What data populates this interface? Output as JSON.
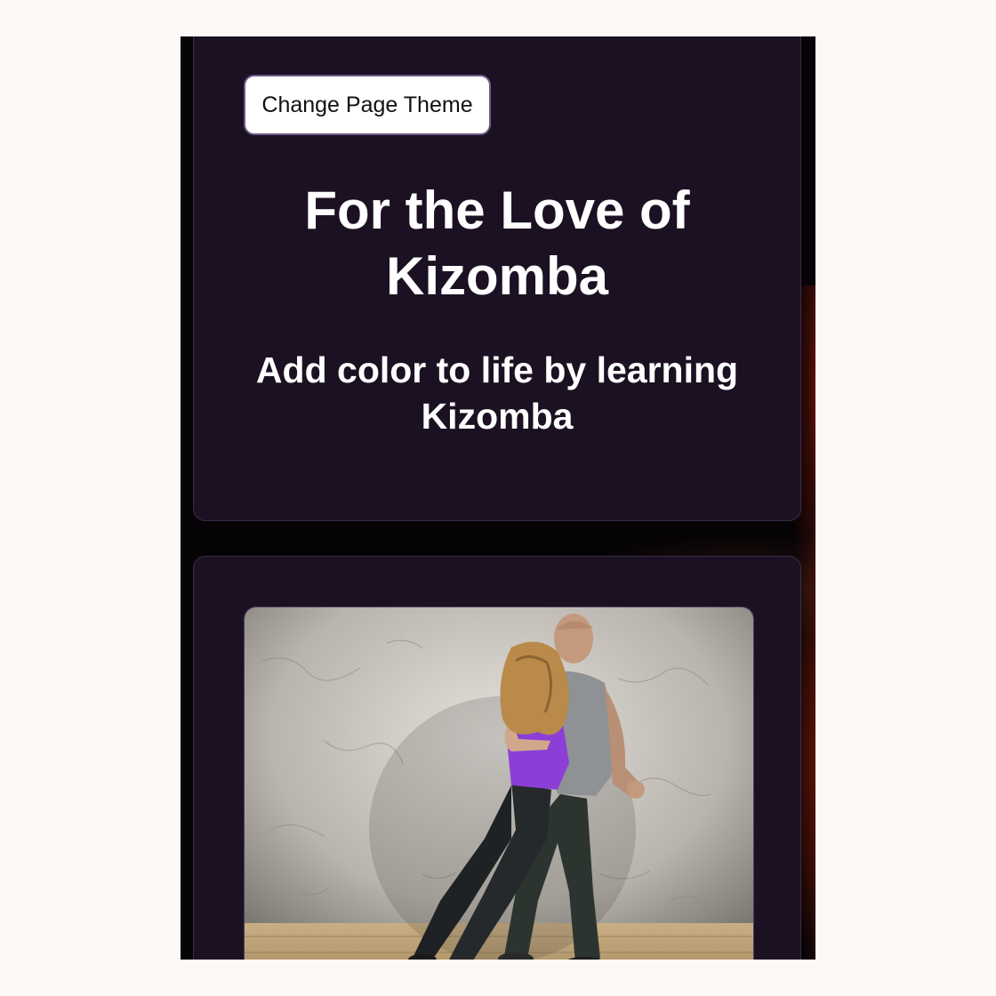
{
  "page": {
    "background": "#fdf9f6",
    "card_color": "#1b1122",
    "accent_glow": "#d83a14"
  },
  "header": {
    "theme_button_label": "Change Page Theme"
  },
  "hero": {
    "title": "For the Love of Kizomba",
    "subtitle": "Add color to life by learning Kizomba"
  },
  "media": {
    "photo_subject": "couple-dancing-photo"
  }
}
